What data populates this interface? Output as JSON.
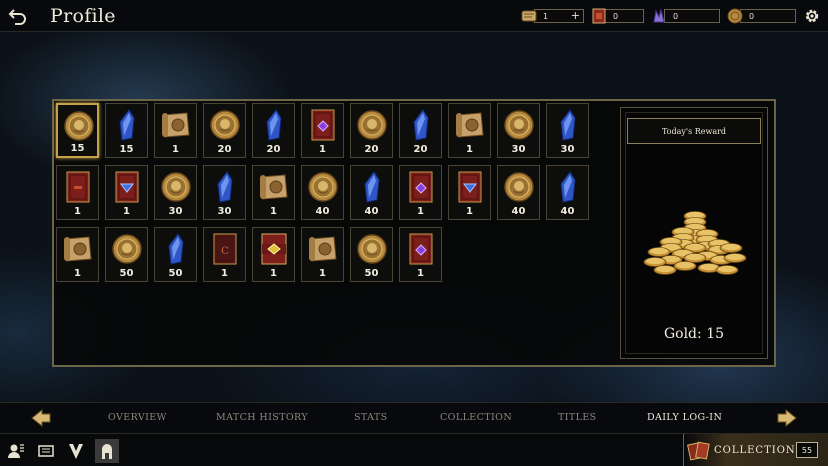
{
  "header": {
    "title": "Profile",
    "currencies": [
      {
        "icon": "scroll-icon",
        "value": "1",
        "has_plus": true,
        "plus_label": "+"
      },
      {
        "icon": "card-pack-icon",
        "value": "0",
        "has_plus": false
      },
      {
        "icon": "crystal-icon",
        "value": "0",
        "has_plus": false
      },
      {
        "icon": "gold-coin-icon",
        "value": "0",
        "has_plus": false
      }
    ]
  },
  "rewards": {
    "rows": [
      [
        {
          "type": "coin",
          "amount": "15",
          "selected": true
        },
        {
          "type": "crystal",
          "amount": "15"
        },
        {
          "type": "scroll",
          "amount": "1"
        },
        {
          "type": "coin",
          "amount": "20"
        },
        {
          "type": "crystal",
          "amount": "20"
        },
        {
          "type": "pack-purple",
          "amount": "1"
        },
        {
          "type": "coin",
          "amount": "20"
        },
        {
          "type": "crystal",
          "amount": "20"
        },
        {
          "type": "scroll",
          "amount": "1"
        },
        {
          "type": "coin",
          "amount": "30"
        },
        {
          "type": "crystal",
          "amount": "30"
        }
      ],
      [
        {
          "type": "pack-plain",
          "amount": "1"
        },
        {
          "type": "pack-blue",
          "amount": "1"
        },
        {
          "type": "coin",
          "amount": "30"
        },
        {
          "type": "crystal",
          "amount": "30"
        },
        {
          "type": "scroll",
          "amount": "1"
        },
        {
          "type": "coin",
          "amount": "40"
        },
        {
          "type": "crystal",
          "amount": "40"
        },
        {
          "type": "pack-purple",
          "amount": "1"
        },
        {
          "type": "pack-blue",
          "amount": "1"
        },
        {
          "type": "coin",
          "amount": "40"
        },
        {
          "type": "crystal",
          "amount": "40"
        }
      ],
      [
        {
          "type": "scroll",
          "amount": "1"
        },
        {
          "type": "coin",
          "amount": "50"
        },
        {
          "type": "crystal",
          "amount": "50"
        },
        {
          "type": "pack-c",
          "amount": "1"
        },
        {
          "type": "pack-gold",
          "amount": "1"
        },
        {
          "type": "scroll",
          "amount": "1"
        },
        {
          "type": "coin",
          "amount": "50"
        },
        {
          "type": "pack-purple",
          "amount": "1"
        }
      ]
    ]
  },
  "today": {
    "heading": "Today's Reward",
    "reward_text": "Gold: 15",
    "icon": "gold-pile-icon"
  },
  "tabs": [
    {
      "label": "OVERVIEW",
      "active": false
    },
    {
      "label": "MATCH HISTORY",
      "active": false
    },
    {
      "label": "STATS",
      "active": false
    },
    {
      "label": "COLLECTION",
      "active": false
    },
    {
      "label": "TITLES",
      "active": false
    },
    {
      "label": "DAILY LOG-IN",
      "active": true
    }
  ],
  "bottom": {
    "icons": [
      "profile-icon",
      "deck-icon",
      "faction-icon",
      "helmet-icon"
    ],
    "active_icon": "helmet-icon",
    "collection_label": "COLLECTION",
    "collection_count": "55"
  },
  "colors": {
    "gold_border": "#6d6547",
    "selected_border": "#c7a04a",
    "active_tab": "#f0ead8",
    "inactive_tab": "#8c887c"
  }
}
